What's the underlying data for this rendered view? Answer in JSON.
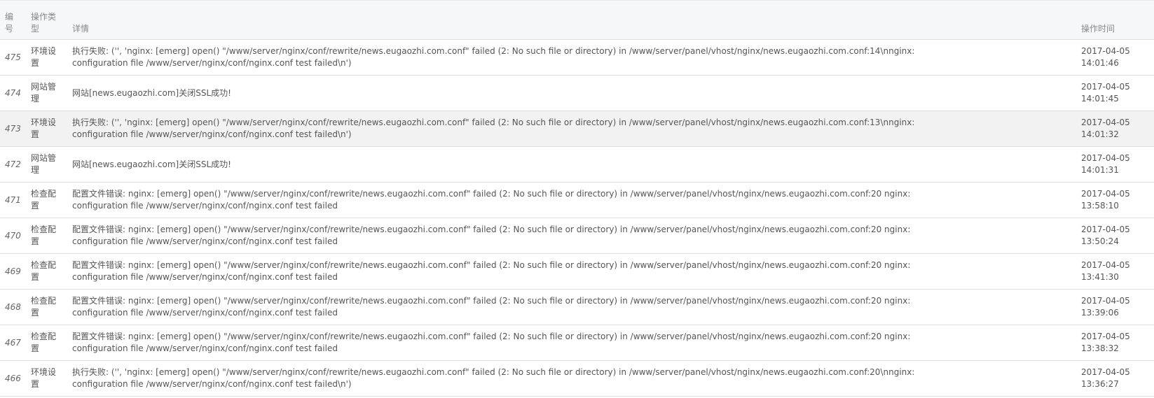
{
  "table": {
    "headers": {
      "id": "编号",
      "type": "操作类型",
      "detail": "详情",
      "time": "操作时间"
    },
    "rows": [
      {
        "id": "475",
        "type": "环境设置",
        "detail": "执行失败: ('', 'nginx: [emerg] open() \"/www/server/nginx/conf/rewrite/news.eugaozhi.com.conf\" failed (2: No such file or directory) in /www/server/panel/vhost/nginx/news.eugaozhi.com.conf:14\\nnginx: configuration file /www/server/nginx/conf/nginx.conf test failed\\n')",
        "time": "2017-04-05 14:01:46"
      },
      {
        "id": "474",
        "type": "网站管理",
        "detail": "网站[news.eugaozhi.com]关闭SSL成功!",
        "time": "2017-04-05 14:01:45"
      },
      {
        "id": "473",
        "type": "环境设置",
        "detail": "执行失败: ('', 'nginx: [emerg] open() \"/www/server/nginx/conf/rewrite/news.eugaozhi.com.conf\" failed (2: No such file or directory) in /www/server/panel/vhost/nginx/news.eugaozhi.com.conf:13\\nnginx: configuration file /www/server/nginx/conf/nginx.conf test failed\\n')",
        "time": "2017-04-05 14:01:32"
      },
      {
        "id": "472",
        "type": "网站管理",
        "detail": "网站[news.eugaozhi.com]关闭SSL成功!",
        "time": "2017-04-05 14:01:31"
      },
      {
        "id": "471",
        "type": "检查配置",
        "detail": "配置文件错误: nginx: [emerg] open() \"/www/server/nginx/conf/rewrite/news.eugaozhi.com.conf\" failed (2: No such file or directory) in /www/server/panel/vhost/nginx/news.eugaozhi.com.conf:20 nginx: configuration file /www/server/nginx/conf/nginx.conf test failed",
        "time": "2017-04-05 13:58:10"
      },
      {
        "id": "470",
        "type": "检查配置",
        "detail": "配置文件错误: nginx: [emerg] open() \"/www/server/nginx/conf/rewrite/news.eugaozhi.com.conf\" failed (2: No such file or directory) in /www/server/panel/vhost/nginx/news.eugaozhi.com.conf:20 nginx: configuration file /www/server/nginx/conf/nginx.conf test failed",
        "time": "2017-04-05 13:50:24"
      },
      {
        "id": "469",
        "type": "检查配置",
        "detail": "配置文件错误: nginx: [emerg] open() \"/www/server/nginx/conf/rewrite/news.eugaozhi.com.conf\" failed (2: No such file or directory) in /www/server/panel/vhost/nginx/news.eugaozhi.com.conf:20 nginx: configuration file /www/server/nginx/conf/nginx.conf test failed",
        "time": "2017-04-05 13:41:30"
      },
      {
        "id": "468",
        "type": "检查配置",
        "detail": "配置文件错误: nginx: [emerg] open() \"/www/server/nginx/conf/rewrite/news.eugaozhi.com.conf\" failed (2: No such file or directory) in /www/server/panel/vhost/nginx/news.eugaozhi.com.conf:20 nginx: configuration file /www/server/nginx/conf/nginx.conf test failed",
        "time": "2017-04-05 13:39:06"
      },
      {
        "id": "467",
        "type": "检查配置",
        "detail": "配置文件错误: nginx: [emerg] open() \"/www/server/nginx/conf/rewrite/news.eugaozhi.com.conf\" failed (2: No such file or directory) in /www/server/panel/vhost/nginx/news.eugaozhi.com.conf:20 nginx: configuration file /www/server/nginx/conf/nginx.conf test failed",
        "time": "2017-04-05 13:38:32"
      },
      {
        "id": "466",
        "type": "环境设置",
        "detail": "执行失败: ('', 'nginx: [emerg] open() \"/www/server/nginx/conf/rewrite/news.eugaozhi.com.conf\" failed (2: No such file or directory) in /www/server/panel/vhost/nginx/news.eugaozhi.com.conf:20\\nnginx: configuration file /www/server/nginx/conf/nginx.conf test failed\\n')",
        "time": "2017-04-05 13:36:27"
      }
    ]
  }
}
